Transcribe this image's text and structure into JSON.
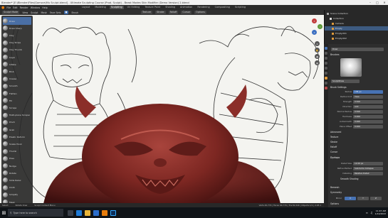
{
  "window": {
    "title": "Blender* [E:\\Blender\\Files\\Gomora\\Mu Sculpt.blend] - Ultimate Sculpting Course (Prod. Sculpt) - Beast Modes Skin Modifier (Demo Version) 2.blend"
  },
  "menu": {
    "items": [
      "File",
      "Edit",
      "Render",
      "Window",
      "Help"
    ],
    "workspaces": [
      "Layout",
      "Modeling",
      "Sculpting",
      "UV Editing",
      "Texture Paint",
      "Shading",
      "Animation",
      "Rendering",
      "Compositing",
      "Scripting"
    ],
    "active_workspace": "Sculpting"
  },
  "header": {
    "mode": "Sculpt Mode",
    "view": "View",
    "sculpt": "Sculpt",
    "mask": "Mask",
    "face_sets": "Face Sets",
    "brush": "Brush",
    "texture": "Texture",
    "stroke": "Stroke",
    "falloff": "Falloff",
    "cursor": "Cursor",
    "options": "Options"
  },
  "tools": [
    "Draw",
    "Draw Sharp",
    "Clay",
    "Clay Strips",
    "Clay Thumb",
    "Layer",
    "Inflate",
    "Blob",
    "Crease",
    "Smooth",
    "Flatten",
    "Fill",
    "Scrape",
    "Multi-plane Scraper",
    "Pinch",
    "Grab",
    "Elastic Deform",
    "Snake Hook",
    "Thumb",
    "Pose",
    "Nudge",
    "Rotate",
    "Slide Relax",
    "Cloth",
    "Simplify",
    "Mask"
  ],
  "active_tool": "Draw",
  "outliner": {
    "rows": [
      "Scene Collection",
      "Collection",
      "Camera",
      "Empty",
      "Empty.001",
      "Empty.002"
    ],
    "selected_index": 3
  },
  "properties": {
    "brush_name": "Draw",
    "sculpt_draw": "SculptDraw",
    "sections": [
      "Brushes",
      "Brush Settings",
      "Advanced",
      "Texture",
      "Stroke",
      "Falloff",
      "Cursor",
      "Dyntopo",
      "Remesh",
      "Symmetry",
      "Options"
    ],
    "fields": [
      {
        "label": "Radius",
        "value": "138 px"
      },
      {
        "label": "Radius Unit",
        "value": "View"
      },
      {
        "label": "Strength",
        "value": "0.500"
      },
      {
        "label": "Direction",
        "value": "Add"
      },
      {
        "label": "Normal Radius",
        "value": "0.500"
      },
      {
        "label": "Hardness",
        "value": "0.000"
      },
      {
        "label": "Autosmooth",
        "value": "0.000"
      },
      {
        "label": "Plane Offset",
        "value": "0.000"
      },
      {
        "label": "Detail Size",
        "value": "12.00 px"
      },
      {
        "label": "Refine Method",
        "value": "Subdivide Collapse"
      },
      {
        "label": "Detailing",
        "value": "Relative Detail"
      }
    ],
    "smooth_shading": "Smooth Shading",
    "mirror_label": "Mirror",
    "mirror_x": "X",
    "mirror_y": "Y",
    "mirror_z": "Z"
  },
  "status": {
    "left": "Select",
    "middle": "Rotate View",
    "right": "Sculpt Context Menu",
    "stats": "Verts 40,772 | Faces 40,770 | Tris 81,540 | Objects 1/1 | 2.93.1"
  },
  "taskbar": {
    "search_placeholder": "Type here to search",
    "time": "11:47 AM",
    "date": "1/12/2022"
  },
  "colors": {
    "accent": "#4772b3",
    "sculpt_red": "#8e2f2b",
    "outliner_sel": "#3d5a80"
  }
}
